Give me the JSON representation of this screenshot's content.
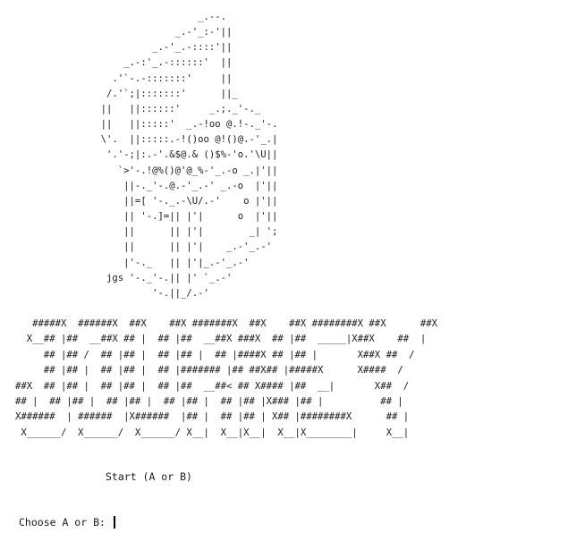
{
  "screen": {
    "cup_art": "                                _.--.\n                            _.-'_:-'||\n                        _.-'_.-::::'||\n                   _.-:'_.-::::::'  ||\n                 .'`-.-:::::::'     ||\n                /.'`;|:::::::'      ||_\n               ||   ||::::::'     _.;._'-._\n               ||   ||:::::'  _.-!oo @.!-._'-.\n               \\'.  ||:::::.-!()oo @!()@.-'_.|\n                '.'-;|:.-'.&$@.& ()$%-'o.'\\U||\n                  `>'-.!@%()@'@_%-'_.-o _.|'||\n                   ||-._'-.@.-'_.-' _.-o  |'||\n                   ||=[ '-._.-\\U/.-'    o |'||\n                   || '-.]=|| |'|      o  |'||\n                   ||      || |'|        _| ';\n                   ||      || |'|    _.-'_.-'\n                   |'-._   || |'|_.-'_.-'\n                jgs '-._'-.|| |' `_.-'\n                        '-.||_/.-'",
    "title_art": "   #####X  ######X  ##X    ##X #######X  ##X    ##X ########X ##X      ##X\n  X__## |##  __##X ## |  ## |##  __##X ###X  ## |##  _____|X##X    ##  |\n     ## |## /  ## |## |  ## |## |  ## |####X ## |## |       X##X ##  /\n     ## |## |  ## |## |  ## |####### |## ##X## |#####X      X####  /\n##X  ## |## |  ## |## |  ## |##  __##< ## X#### |##  __|       X##  /\n## |  ## |## |  ## |## |  ## |## |  ## |## |X### |## |          ## |\nX######  | ######  |X######  |## |  ## |## | X## |########X      ## |\n X______/  X______/  X______/ X__|  X__|X__|  X__|X________|     X__|",
    "start_text": "Start (A or B)",
    "prompt_text": "Choose A or B: "
  }
}
